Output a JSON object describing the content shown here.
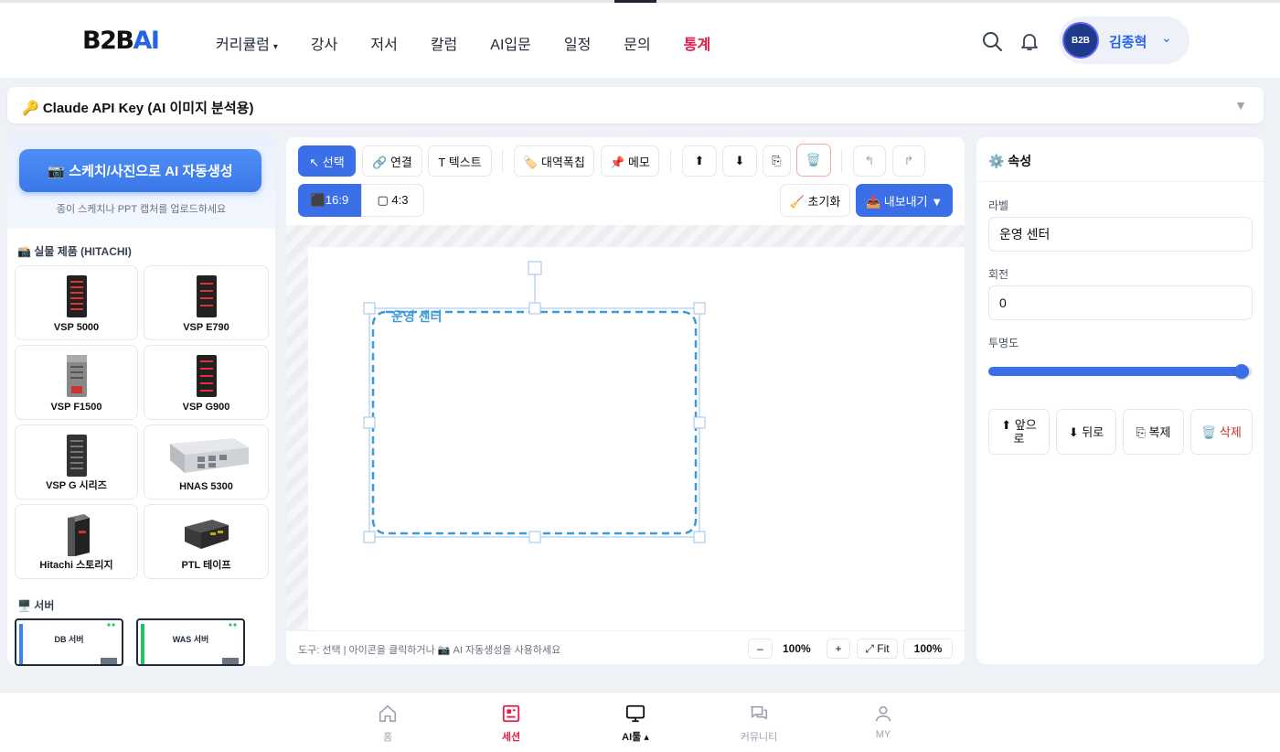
{
  "header": {
    "logo_main": "B2B",
    "logo_ai": "AI",
    "nav": [
      {
        "label": "커리큘럼",
        "has_caret": true
      },
      {
        "label": "강사"
      },
      {
        "label": "저서"
      },
      {
        "label": "칼럼"
      },
      {
        "label": "AI입문"
      },
      {
        "label": "일정"
      },
      {
        "label": "문의"
      },
      {
        "label": "통계",
        "active": true
      }
    ],
    "nav_caret": "▾",
    "user_name": "김종혁",
    "user_caret": "⌄",
    "avatar_text": "B2B"
  },
  "api_bar": {
    "title": "🔑 Claude API Key (AI 이미지 분석용)",
    "caret": "▼"
  },
  "left": {
    "ai_button": "📷 스케치/사진으로 AI 자동생성",
    "ai_subtitle": "종이 스케치나 PPT 캡처를 업로드하세요",
    "section_products": "📸 실물 제품 (HITACHI)",
    "products": [
      {
        "label": "VSP 5000"
      },
      {
        "label": "VSP E790"
      },
      {
        "label": "VSP F1500"
      },
      {
        "label": "VSP G900"
      },
      {
        "label": "VSP G 시리즈"
      },
      {
        "label": "HNAS 5300"
      },
      {
        "label": "Hitachi 스토리지"
      },
      {
        "label": "PTL 테이프"
      }
    ],
    "section_servers": "🖥️ 서버",
    "servers": [
      {
        "label": "DB 서버",
        "accent": "#3b82f6"
      },
      {
        "label": "WAS 서버",
        "accent": "#22c55e"
      }
    ]
  },
  "toolbar": {
    "select": "↖ 선택",
    "connect": "🔗 연결",
    "text": "T 텍스트",
    "banner": "🏷️ 대역폭칩",
    "memo": "📌 메모",
    "up": "⬆",
    "down": "⬇",
    "copy": "⎘",
    "delete": "🗑️",
    "undo": "↰",
    "redo": "↱",
    "ratio_169": "⬛16:9",
    "ratio_43": "▢ 4:3",
    "reset": "🧹 초기화",
    "export": "📤 내보내기 ▼"
  },
  "canvas": {
    "group_label": "운영 센터"
  },
  "statusbar": {
    "text": "도구: 선택 | 아이콘을 클릭하거나 📷 AI 자동생성을 사용하세요",
    "minus": "–",
    "zoom": "100%",
    "plus": "+",
    "fit": "⤢ Fit",
    "zoom2": "100%"
  },
  "properties": {
    "title": "⚙️ 속성",
    "label_label": "라벨",
    "label_value": "운영 센터",
    "rotation_label": "회전",
    "rotation_value": "0",
    "opacity_label": "투명도",
    "opacity_value": 0.96,
    "btn_front": "⬆ 앞으로",
    "btn_back": "⬇ 뒤로",
    "btn_copy": "⎘ 복제",
    "btn_delete": "🗑️ 삭제"
  },
  "bottom_nav": [
    {
      "label": "홈",
      "icon": "home-icon"
    },
    {
      "label": "세션",
      "icon": "news-icon"
    },
    {
      "label": "AI툴 ▴",
      "icon": "monitor-icon"
    },
    {
      "label": "커뮤니티",
      "icon": "chat-icon"
    },
    {
      "label": "MY",
      "icon": "user-icon"
    }
  ],
  "colors": {
    "accent": "#3b6fe8",
    "active_nav": "#e11d48",
    "selection": "#3b9ad9"
  }
}
